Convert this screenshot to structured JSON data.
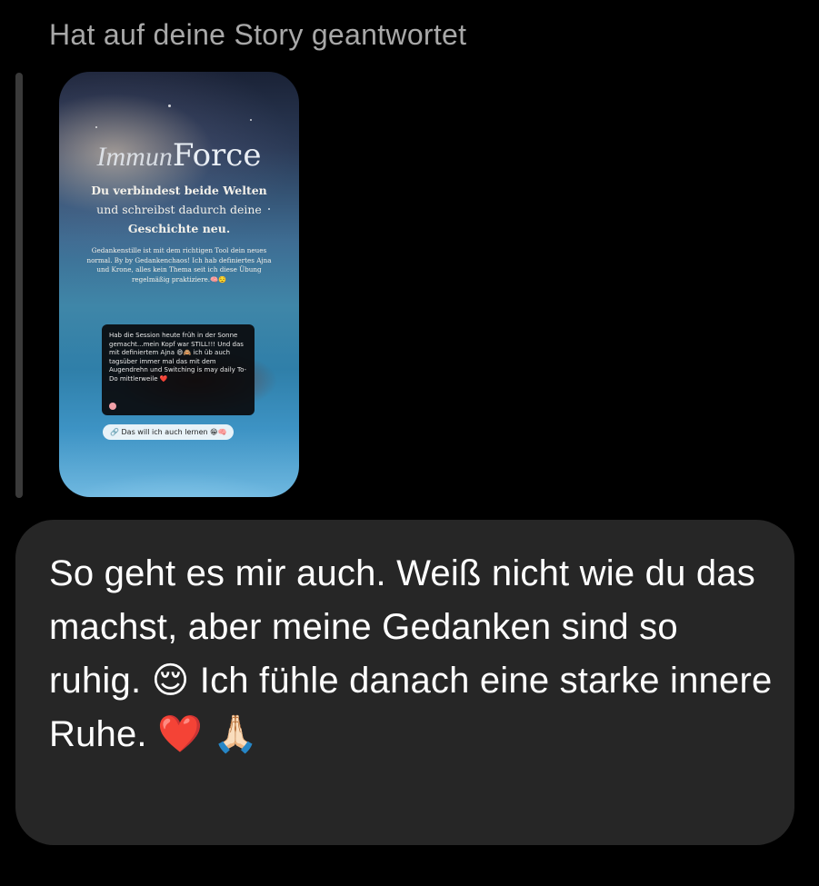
{
  "header": {
    "text": "Hat auf deine Story geantwortet"
  },
  "story": {
    "title_script": "Immun",
    "title_main": "Force",
    "sub_line1": "Du verbindest beide Welten",
    "sub_line2": "und schreibst dadurch deine",
    "sub_line3": "Geschichte neu.",
    "body": "Gedankenstille ist mit dem richtigen Tool dein neues normal. By by Gedankenchaos! Ich hab definiertes Ajna und Krone, alles kein Thema seit ich diese Übung regelmäßig praktiziere.🧠😌",
    "card_text": "Hab die Session heute früh in der Sonne gemacht...mein Kopf war STILL!!! Und das mit definiertem Ajna 😄🙈 ich üb auch tagsüber immer mal das mit dem Augendrehn und Switching is may daily To-Do mittlerweile ❤️",
    "link_text": "🔗 Das will ich auch lernen 😁🧠"
  },
  "message": {
    "text": "So geht es mir auch. Weiß nicht wie du das machst, aber meine Gedanken sind so ruhig. 😌 Ich fühle danach eine starke innere Ruhe. ❤️ 🙏🏻"
  },
  "colors": {
    "background": "#000000",
    "bubble": "#262626",
    "header_text": "#a8a8a8",
    "message_text": "#ffffff"
  }
}
